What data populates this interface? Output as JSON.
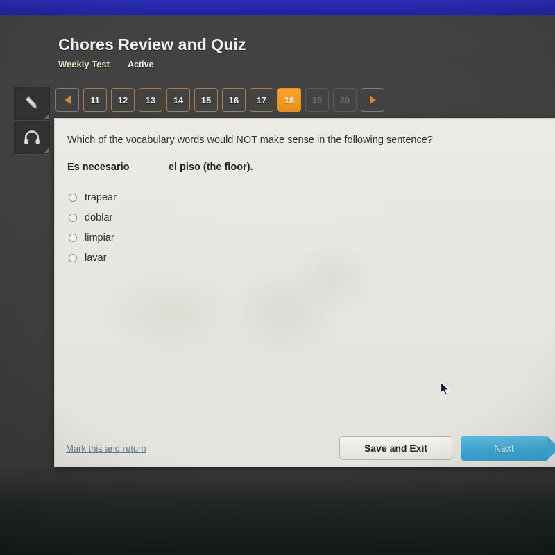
{
  "header": {
    "title": "Chores Review and Quiz",
    "lesson_type": "Weekly Test",
    "status": "Active"
  },
  "tool_rail": {
    "items": [
      {
        "icon": "pencil-icon",
        "label": "Annotate"
      },
      {
        "icon": "headphones-icon",
        "label": "Audio"
      }
    ]
  },
  "pagination": {
    "prev_label": "◀",
    "next_label": "▶",
    "pages": [
      {
        "label": "11",
        "state": "available"
      },
      {
        "label": "12",
        "state": "available"
      },
      {
        "label": "13",
        "state": "available"
      },
      {
        "label": "14",
        "state": "available"
      },
      {
        "label": "15",
        "state": "available"
      },
      {
        "label": "16",
        "state": "available"
      },
      {
        "label": "17",
        "state": "available"
      },
      {
        "label": "18",
        "state": "current"
      },
      {
        "label": "19",
        "state": "disabled"
      },
      {
        "label": "20",
        "state": "disabled"
      }
    ]
  },
  "question": {
    "prompt": "Which of the vocabulary words would NOT make sense in the following sentence?",
    "sentence": "Es necesario ______ el piso (the floor).",
    "choices": [
      {
        "label": "trapear",
        "selected": false
      },
      {
        "label": "doblar",
        "selected": false
      },
      {
        "label": "limpiar",
        "selected": false
      },
      {
        "label": "lavar",
        "selected": false
      }
    ]
  },
  "footer": {
    "mark_link": "Mark this and return",
    "save_exit": "Save and Exit",
    "next": "Next"
  },
  "colors": {
    "top_bar": "#2226a8",
    "app_background": "#403f3f",
    "accent_orange": "#f2941c",
    "next_blue": "#3fa7d4",
    "panel_background": "#e9e8e3",
    "link_blue": "#5f7d95",
    "lesson_type_text": "#e8dfbe"
  }
}
